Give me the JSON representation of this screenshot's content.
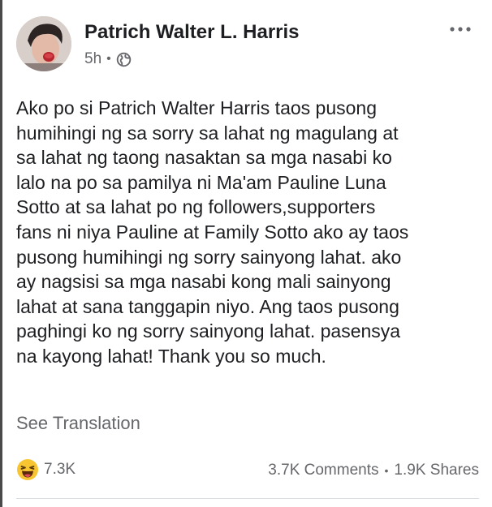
{
  "post": {
    "author": "Patrich Walter L. Harris",
    "time": "5h",
    "separator": "•",
    "privacy_icon": "globe-icon",
    "more_icon": "more-options-icon",
    "body_lines": [
      "Ako po si Patrich Walter Harris taos pusong",
      "humihingi ng sa sorry sa lahat ng magulang at",
      "sa lahat ng taong nasaktan sa mga nasabi ko",
      "lalo na po sa pamilya ni Ma'am Pauline Luna",
      "Sotto at sa lahat po ng followers,supporters",
      "fans ni niya Pauline at Family Sotto ako ay taos",
      "pusong humihingi ng sorry sainyong lahat. ako",
      "ay nagsisi sa mga nasabi kong mali sainyong",
      "lahat at sana tanggapin niyo. Ang taos pusong",
      "paghingi ko ng sorry sainyong lahat. pasensya",
      "na kayong lahat! Thank you so much."
    ],
    "see_translation": "See Translation"
  },
  "stats": {
    "reaction_icon": "haha-reaction-icon",
    "reactions": "7.3K",
    "comments": "3.7K Comments",
    "separator": "•",
    "shares": "1.9K Shares"
  },
  "colors": {
    "text_primary": "#1c1e21",
    "text_secondary": "#65676b",
    "haha_yellow": "#f7c532",
    "divider": "#dadde1"
  }
}
